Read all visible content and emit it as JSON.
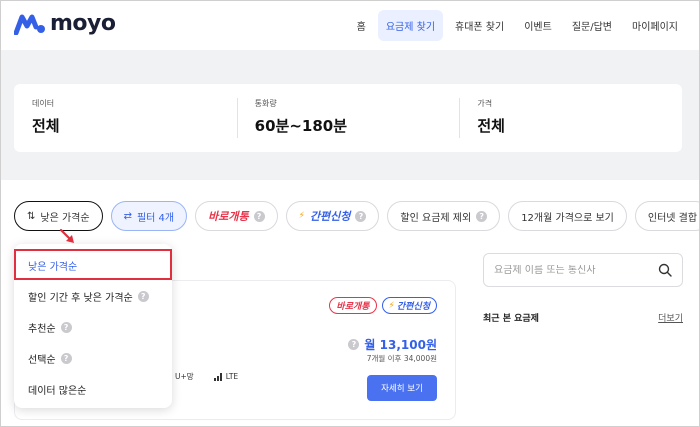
{
  "brand": {
    "name": "moyo",
    "accent": "#3460e8",
    "alert": "#e0303f"
  },
  "nav": {
    "items": [
      {
        "label": "홈",
        "active": false
      },
      {
        "label": "요금제 찾기",
        "active": true
      },
      {
        "label": "휴대폰 찾기",
        "active": false
      },
      {
        "label": "이벤트",
        "active": false
      },
      {
        "label": "질문/답변",
        "active": false
      },
      {
        "label": "마이페이지",
        "active": false
      }
    ]
  },
  "summary": {
    "data": {
      "label": "데이터",
      "value": "전체"
    },
    "calls": {
      "label": "통화량",
      "value": "60분~180분"
    },
    "price": {
      "label": "가격",
      "value": "전체"
    }
  },
  "filters": {
    "sort_label": "낮은 가격순",
    "filter_label": "필터 4개",
    "instant_label": "바로개통",
    "simple_label": "간편신청",
    "exclude_discount_label": "할인 요금제 제외",
    "twelve_month_label": "12개월 가격으로 보기",
    "internet_label": "인터넷 결합"
  },
  "sort_dropdown": {
    "items": [
      {
        "label": "낮은 가격순",
        "selected": true,
        "help": false
      },
      {
        "label": "할인 기간 후 낮은 가격순",
        "selected": false,
        "help": true
      },
      {
        "label": "추천순",
        "selected": false,
        "help": true
      },
      {
        "label": "선택순",
        "selected": false,
        "help": true
      },
      {
        "label": "데이터 많은순",
        "selected": false,
        "help": false
      }
    ]
  },
  "plan_card": {
    "badge_instant": "바로개통",
    "badge_simple": "간편신청",
    "price": "월 13,100원",
    "price_after": "7개월 이후 34,000원",
    "carrier": "U+망",
    "network": "LTE",
    "detail_button": "자세히 보기"
  },
  "sidebar": {
    "search_placeholder": "요금제 이름 또는 통신사",
    "recent_title": "최근 본 요금제",
    "more_link": "더보기"
  },
  "icons": {
    "help": "?",
    "bolt": "⚡",
    "sort": "⇅",
    "filter": "⇄"
  }
}
